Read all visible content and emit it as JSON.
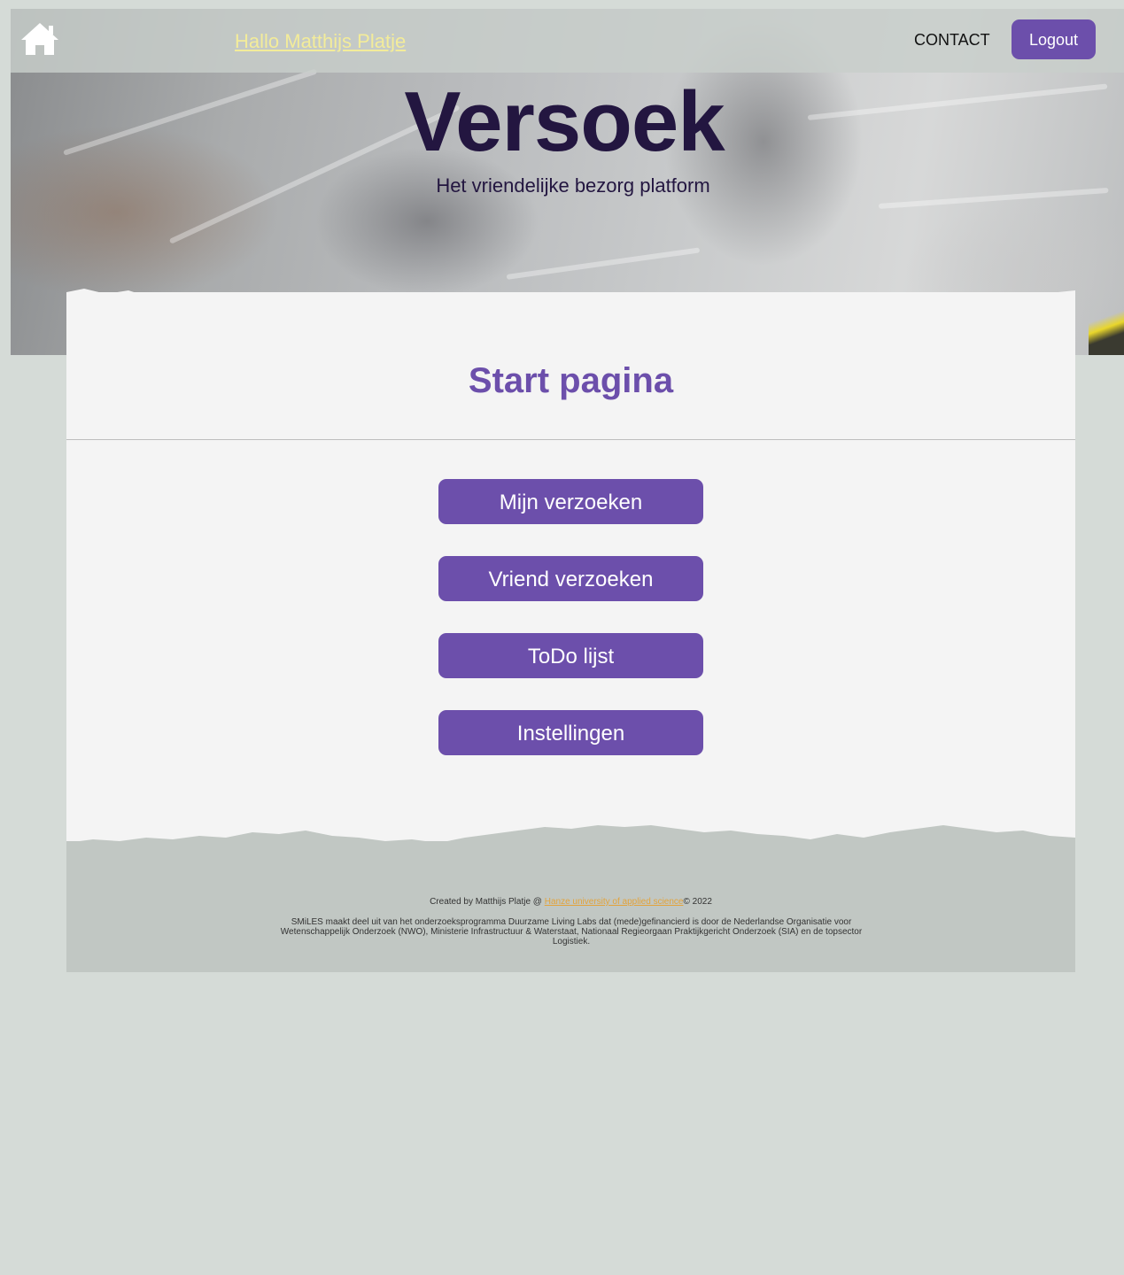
{
  "header": {
    "greeting": "Hallo Matthijs Platje",
    "contact_label": "CONTACT",
    "logout_label": "Logout"
  },
  "hero": {
    "title": "Versoek",
    "subtitle": "Het vriendelijke bezorg platform"
  },
  "main": {
    "page_title": "Start pagina",
    "buttons": [
      {
        "label": "Mijn verzoeken"
      },
      {
        "label": "Vriend verzoeken"
      },
      {
        "label": "ToDo lijst"
      },
      {
        "label": "Instellingen"
      }
    ]
  },
  "footer": {
    "credit_prefix": "Created by Matthijs Platje @ ",
    "credit_link": "Hanze university of applied science",
    "credit_suffix": "© 2022",
    "note": "SMiLES maakt deel uit van het onderzoeksprogramma Duurzame Living Labs dat (mede)gefinancierd is door de Nederlandse Organisatie voor Wetenschappelijk Onderzoek (NWO), Ministerie Infrastructuur & Waterstaat, Nationaal Regieorgaan Praktijkgericht Onderzoek (SIA) en de topsector Logistiek."
  },
  "colors": {
    "accent": "#6c4fab",
    "brand_dark": "#231640",
    "greeting": "#f3ec9a",
    "link": "#e2a33c",
    "background": "#d5dbd7",
    "card": "#f4f4f4",
    "footer": "#c1c7c3"
  },
  "icons": {
    "home": "home-icon"
  }
}
